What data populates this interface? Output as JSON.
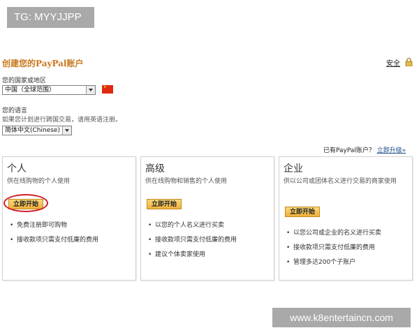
{
  "tag": "TG: MYYJJPP",
  "watermark": "www.k8entertaincn.com",
  "page": {
    "title": "创建您的PayPal账户",
    "security_link": "安全",
    "country_label": "您的国家或地区",
    "country_value": "中国（全球范围）",
    "language_label": "您的语言",
    "language_hint": "如果您计划进行跨国交易，请用英语注册。",
    "language_value": "简体中文(Chinese)",
    "upgrade_prompt": "已有PayPal账户？",
    "upgrade_link": "立即升级»"
  },
  "accounts": [
    {
      "title": "个人",
      "description": "供在线购物的个人使用",
      "button": "立即开始",
      "features": [
        "免费注册即可购物",
        "接收款项只需支付低廉的费用"
      ]
    },
    {
      "title": "高级",
      "description": "供在线购物和销售的个人使用",
      "button": "立即开始",
      "features": [
        "以您的个人名义进行买卖",
        "接收款项只需支付低廉的费用",
        "建议个体卖家使用"
      ]
    },
    {
      "title": "企业",
      "description": "供以公司或团体名义进行交易的商家使用",
      "button": "立即开始",
      "features": [
        "以您公司或企业的名义进行买卖",
        "接收款项只需支付低廉的费用",
        "管理多达200个子账户"
      ]
    }
  ],
  "colors": {
    "title": "#c8781c",
    "button": "#f0b13a",
    "highlight_ring": "#d0202a"
  },
  "icons": {
    "security": "lock-icon",
    "country": "china-flag-icon"
  }
}
